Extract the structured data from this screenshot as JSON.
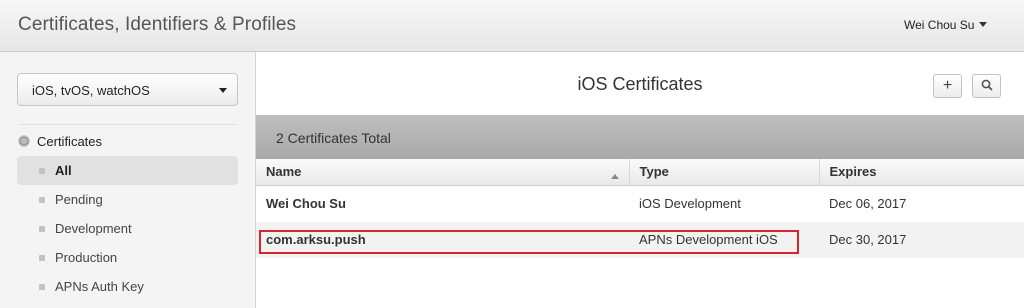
{
  "header": {
    "app_title": "Certificates, Identifiers & Profiles",
    "user_name": "Wei Chou Su"
  },
  "sidebar": {
    "platform_select": "iOS, tvOS, watchOS",
    "section_title": "Certificates",
    "items": [
      {
        "label": "All",
        "active": true
      },
      {
        "label": "Pending",
        "active": false
      },
      {
        "label": "Development",
        "active": false
      },
      {
        "label": "Production",
        "active": false
      },
      {
        "label": "APNs Auth Key",
        "active": false
      }
    ]
  },
  "main": {
    "title": "iOS Certificates",
    "add_button": "+",
    "search_icon": "search-icon",
    "summary": "2 Certificates Total",
    "columns": [
      "Name",
      "Type",
      "Expires"
    ],
    "rows": [
      {
        "name": "Wei Chou Su",
        "type": "iOS Development",
        "expires": "Dec 06, 2017"
      },
      {
        "name": "com.arksu.push",
        "type": "APNs Development iOS",
        "expires": "Dec 30, 2017"
      }
    ]
  },
  "colors": {
    "highlight": "#d9232a"
  }
}
